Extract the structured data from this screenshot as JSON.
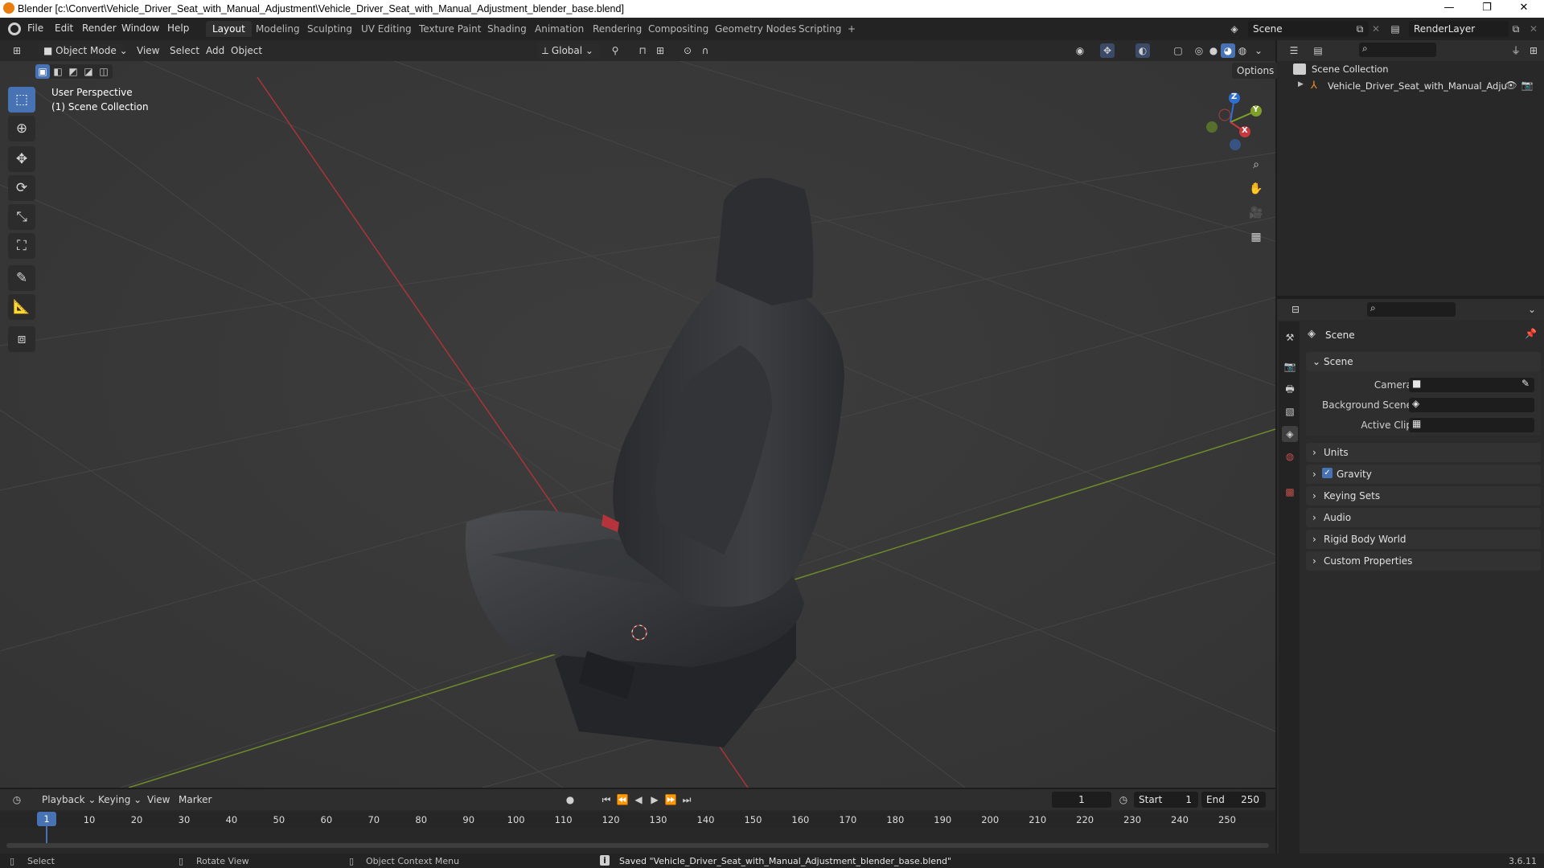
{
  "window": {
    "title": "Blender [c:\\Convert\\Vehicle_Driver_Seat_with_Manual_Adjustment\\Vehicle_Driver_Seat_with_Manual_Adjustment_blender_base.blend]",
    "controls": [
      "—",
      "❐",
      "✕"
    ]
  },
  "menu": {
    "items": [
      "File",
      "Edit",
      "Render",
      "Window",
      "Help"
    ],
    "workspaces": [
      "Layout",
      "Modeling",
      "Sculpting",
      "UV Editing",
      "Texture Paint",
      "Shading",
      "Animation",
      "Rendering",
      "Compositing",
      "Geometry Nodes",
      "Scripting"
    ],
    "add_tab": "+",
    "scene": "Scene",
    "view_layer": "RenderLayer"
  },
  "viewport": {
    "mode": "Object Mode",
    "menus": [
      "View",
      "Select",
      "Add",
      "Object"
    ],
    "orientation": "Global",
    "options": "Options",
    "overlay_line1": "User Perspective",
    "overlay_line2": "(1) Scene Collection",
    "gizmo": {
      "z": "Z",
      "y": "Y",
      "x": "X"
    }
  },
  "outliner": {
    "root": "Scene Collection",
    "object": "Vehicle_Driver_Seat_with_Manual_Adju"
  },
  "properties": {
    "context": "Scene",
    "panel": "Scene",
    "fields": [
      {
        "label": "Camera"
      },
      {
        "label": "Background Scene"
      },
      {
        "label": "Active Clip"
      }
    ],
    "sections": [
      "Units",
      "Gravity",
      "Keying Sets",
      "Audio",
      "Rigid Body World",
      "Custom Properties"
    ],
    "gravity_checked": true
  },
  "timeline": {
    "menus": [
      "Playback",
      "Keying",
      "View",
      "Marker"
    ],
    "current_frame": "1",
    "start_label": "Start",
    "start": "1",
    "end_label": "End",
    "end": "250",
    "ticks": [
      "1",
      "10",
      "20",
      "30",
      "40",
      "50",
      "60",
      "70",
      "80",
      "90",
      "100",
      "110",
      "120",
      "130",
      "140",
      "150",
      "160",
      "170",
      "180",
      "190",
      "200",
      "210",
      "220",
      "230",
      "240",
      "250"
    ]
  },
  "status": {
    "select": "Select",
    "rotate": "Rotate View",
    "context_menu": "Object Context Menu",
    "message": "Saved \"Vehicle_Driver_Seat_with_Manual_Adjustment_blender_base.blend\"",
    "version": "3.6.11"
  },
  "colors": {
    "accent": "#4772b3",
    "x_axis": "#c8393e",
    "y_axis": "#7fa028",
    "z_axis": "#2f6fd1",
    "viewport_bg": "#3a3a3a"
  }
}
